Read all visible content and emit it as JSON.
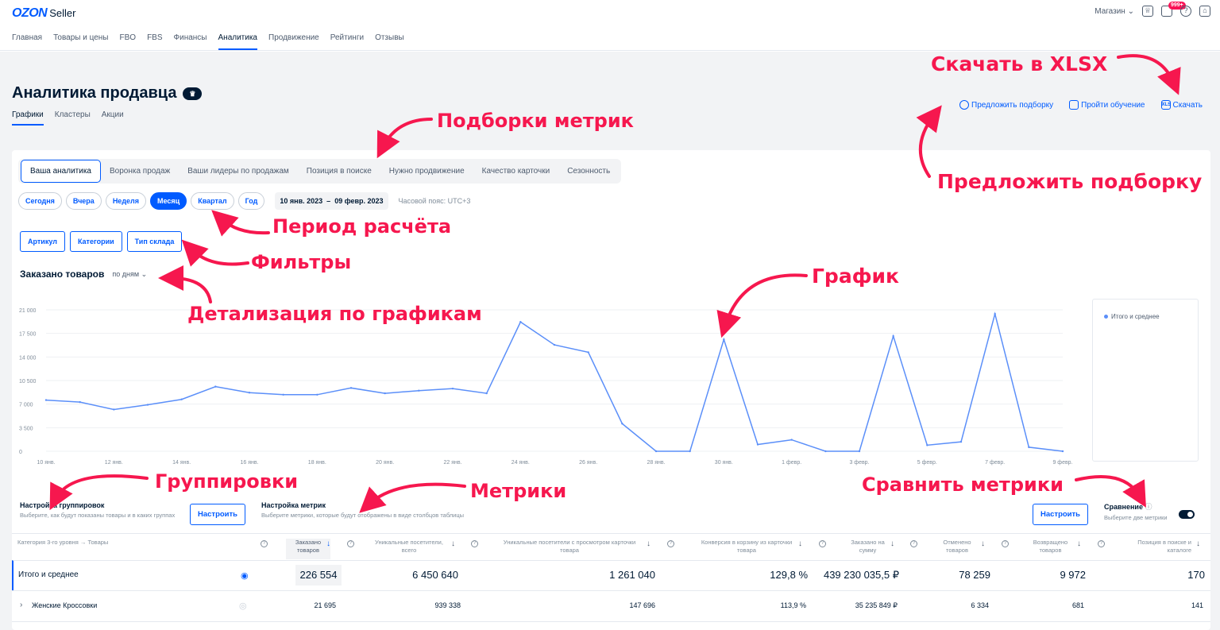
{
  "brand": {
    "logo": "OZON",
    "sub": "Seller"
  },
  "topnav": [
    "Главная",
    "Товары и цены",
    "FBO",
    "FBS",
    "Финансы",
    "Аналитика",
    "Продвижение",
    "Рейтинги",
    "Отзывы"
  ],
  "topright": {
    "store": "Магазин",
    "badge": "999+"
  },
  "page": {
    "title": "Аналитика продавца",
    "tabs": [
      "Графики",
      "Кластеры",
      "Акции"
    ]
  },
  "actions": {
    "suggest": "Предложить подборку",
    "learn": "Пройти обучение",
    "download": "Скачать",
    "xls": "XLS"
  },
  "metric_tabs": [
    "Ваша аналитика",
    "Воронка продаж",
    "Ваши лидеры по продажам",
    "Позиция в поиске",
    "Нужно продвижение",
    "Качество карточки",
    "Сезонность"
  ],
  "periods": [
    "Сегодня",
    "Вчера",
    "Неделя",
    "Месяц",
    "Квартал",
    "Год"
  ],
  "date_from": "10 янв. 2023",
  "date_sep": "–",
  "date_to": "09 февр. 2023",
  "timezone": "Часовой пояс: UTC+3",
  "filters": [
    "Артикул",
    "Категории",
    "Тип склада"
  ],
  "graph": {
    "title": "Заказано товаров",
    "detail": "по дням"
  },
  "chart_data": {
    "type": "line",
    "ylim": [
      0,
      21000
    ],
    "yticks": [
      "21 000",
      "17 500",
      "14 000",
      "10 500",
      "7 000",
      "3 500",
      "0"
    ],
    "x": [
      "10 янв.",
      "11 янв.",
      "12 янв.",
      "13 янв.",
      "14 янв.",
      "15 янв.",
      "16 янв.",
      "17 янв.",
      "18 янв.",
      "19 янв.",
      "20 янв.",
      "21 янв.",
      "22 янв.",
      "23 янв.",
      "24 янв.",
      "25 янв.",
      "26 янв.",
      "27 янв.",
      "28 янв.",
      "29 янв.",
      "30 янв.",
      "31 янв.",
      "1 февр.",
      "2 февр.",
      "3 февр.",
      "4 февр.",
      "5 февр.",
      "6 февр.",
      "7 февр.",
      "8 февр.",
      "9 февр."
    ],
    "xtick_labels": [
      "10 янв.",
      "12 янв.",
      "14 янв.",
      "16 янв.",
      "18 янв.",
      "20 янв.",
      "22 янв.",
      "24 янв.",
      "26 янв.",
      "28 янв.",
      "30 янв.",
      "1 февр.",
      "3 февр.",
      "5 февр.",
      "7 февр.",
      "9 февр."
    ],
    "series": [
      {
        "name": "Итого и среднее",
        "color": "#5b8ff9",
        "values": [
          7600,
          7300,
          6200,
          6900,
          7700,
          9600,
          8700,
          8400,
          8400,
          9400,
          8600,
          9000,
          9300,
          8600,
          19200,
          15800,
          14700,
          4100,
          0,
          0,
          16600,
          1000,
          1700,
          0,
          0,
          17100,
          900,
          1400,
          20400,
          600,
          0
        ]
      }
    ]
  },
  "legend": "Итого и среднее",
  "grouping": {
    "title": "Настройка группировок",
    "desc": "Выберите, как будут показаны товары и в каких группах",
    "button": "Настроить"
  },
  "metrics_cfg": {
    "title": "Настройка метрик",
    "desc": "Выберите метрики, которые будут отображены в виде столбцов таблицы",
    "button": "Настроить"
  },
  "compare": {
    "title": "Сравнение",
    "desc": "Выберите две метрики"
  },
  "table": {
    "headers": [
      "Категория 3-го уровня → Товары",
      "Заказано товаров",
      "Уникальные посетители, всего",
      "Уникальные посетители с просмотром карточки товара",
      "Конверсия в корзину из карточки товара",
      "Заказано на сумму",
      "Отменено товаров",
      "Возвращено товаров",
      "Позиция в поиске и каталоге"
    ],
    "rows": [
      {
        "name": "Итого и среднее",
        "values": [
          "226 554",
          "6 450 640",
          "1 261 040",
          "129,8 %",
          "439 230 035,5 ₽",
          "78 259",
          "9 972",
          "170"
        ]
      },
      {
        "name": "Женские Кроссовки",
        "values": [
          "21 695",
          "939 338",
          "147 696",
          "113,9 %",
          "35 235 849 ₽",
          "6 334",
          "681",
          "141"
        ]
      }
    ]
  },
  "annotations": {
    "xlsx": "Скачать в XLSX",
    "selections": "Подборки метрик",
    "suggest": "Предложить подборку",
    "period": "Период расчёта",
    "filters": "Фильтры",
    "detail": "Детализация по графикам",
    "graph": "График",
    "groupings": "Группировки",
    "metrics": "Метрики",
    "compare": "Сравнить метрики"
  },
  "colors": {
    "accent": "#005bff",
    "annotation": "#f6174e",
    "line": "#5b8ff9"
  }
}
